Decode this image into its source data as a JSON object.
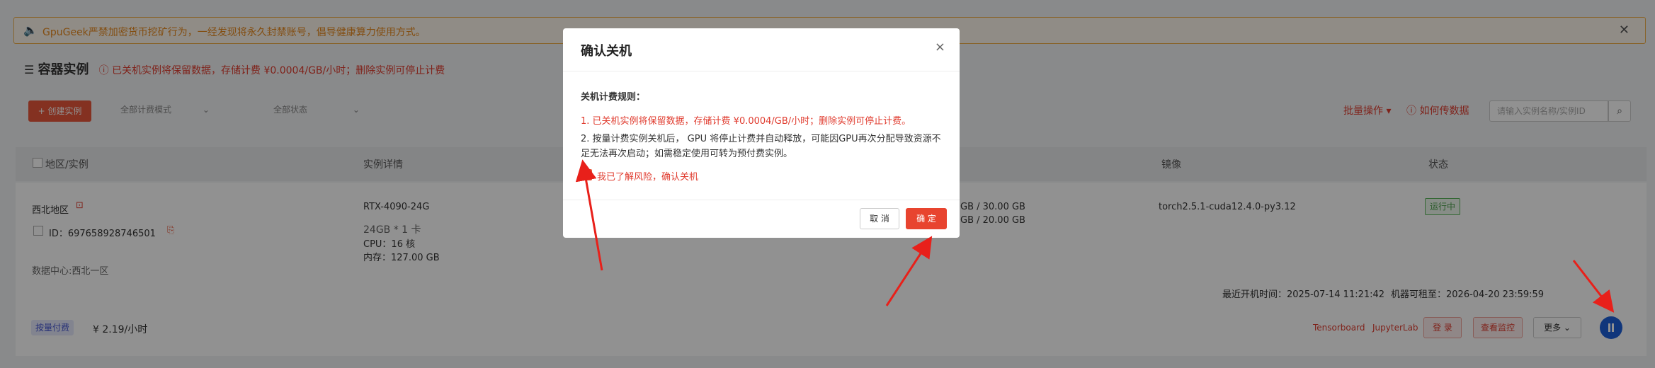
{
  "notice": {
    "text": "GpuGeek严禁加密货币挖矿行为，一经发现将永久封禁账号，倡导健康算力使用方式。",
    "close": "✕"
  },
  "title": {
    "text": "容器实例",
    "warn": "ⓘ 已关机实例将保留数据，存储计费 ¥0.0004/GB/小时；删除实例可停止计费"
  },
  "toolbar": {
    "create": "+ 创建实例",
    "billing_filter": "全部计费模式",
    "status_filter": "全部状态",
    "batch": "批量操作 ▾",
    "howto": "ⓘ 如何传数据",
    "search_placeholder": "请输入实例名称/实例ID"
  },
  "table": {
    "headers": [
      "地区/实例",
      "实例详情",
      "镜像",
      "状态"
    ],
    "row": {
      "region": "西北地区",
      "id": "ID：697658928746501",
      "datacenter": "数据中心:西北一区",
      "gpu": "RTX-4090-24G",
      "gpu_mem": "24GB * 1 卡",
      "cpu": "CPU：16 核",
      "ram": "内存：127.00 GB",
      "disk1": "GB / 30.00 GB",
      "disk2": "GB / 20.00 GB",
      "image": "torch2.5.1-cuda12.4.0-py3.12",
      "status": "运行中",
      "last_boot": "最近开机时间：2025-07-14 11:21:42",
      "rent_until": "机器可租至：2026-04-20 23:59:59",
      "billing_tag": "按量付费",
      "price": "¥ 2.19/小时",
      "tensorboard": "Tensorboard",
      "jupyter": "JupyterLab",
      "login": "登 录",
      "monitor": "查看监控",
      "more": "更多 ⌄"
    }
  },
  "modal": {
    "title": "确认关机",
    "close": "×",
    "rules_title": "关机计费规则：",
    "rule1": "1. 已关机实例将保留数据，存储计费 ¥0.0004/GB/小时；删除实例可停止计费。",
    "rule2": "2. 按量计费实例关机后， GPU 将停止计费并自动释放，可能因GPU再次分配导致资源不足无法再次启动；如需稳定使用可转为预付费实例。",
    "checkbox_label": "我已了解风险，确认关机",
    "cancel": "取 消",
    "ok": "确 定"
  },
  "colors": {
    "accent": "#e8573a",
    "danger": "#e03c2f",
    "pause": "#1d5fd8"
  }
}
